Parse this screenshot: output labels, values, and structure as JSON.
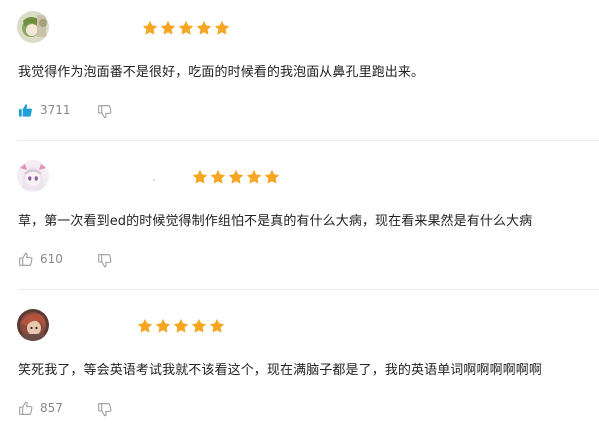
{
  "comments": [
    {
      "avatar": "avatar-green-hair",
      "rating": 5,
      "text": "我觉得作为泡面番不是很好，吃面的时候看的我泡面从鼻孔里跑出来。",
      "likes": "3711",
      "liked": true
    },
    {
      "avatar": "avatar-anime-girl-white",
      "rating": 5,
      "text": "草，第一次看到ed的时候觉得制作组怕不是真的有什么大病，现在看来果然是有什么大病",
      "likes": "610",
      "liked": false
    },
    {
      "avatar": "avatar-red-hair",
      "rating": 5,
      "text": "笑死我了，等会英语考试我就不该看这个，现在满脑子都是了，我的英语单词啊啊啊啊啊啊",
      "likes": "857",
      "liked": false
    }
  ],
  "colors": {
    "star": "#f6a623",
    "like_active": "#1fa0d8",
    "icon_gray": "#9a9a9a",
    "text": "#222222",
    "count": "#888888"
  }
}
